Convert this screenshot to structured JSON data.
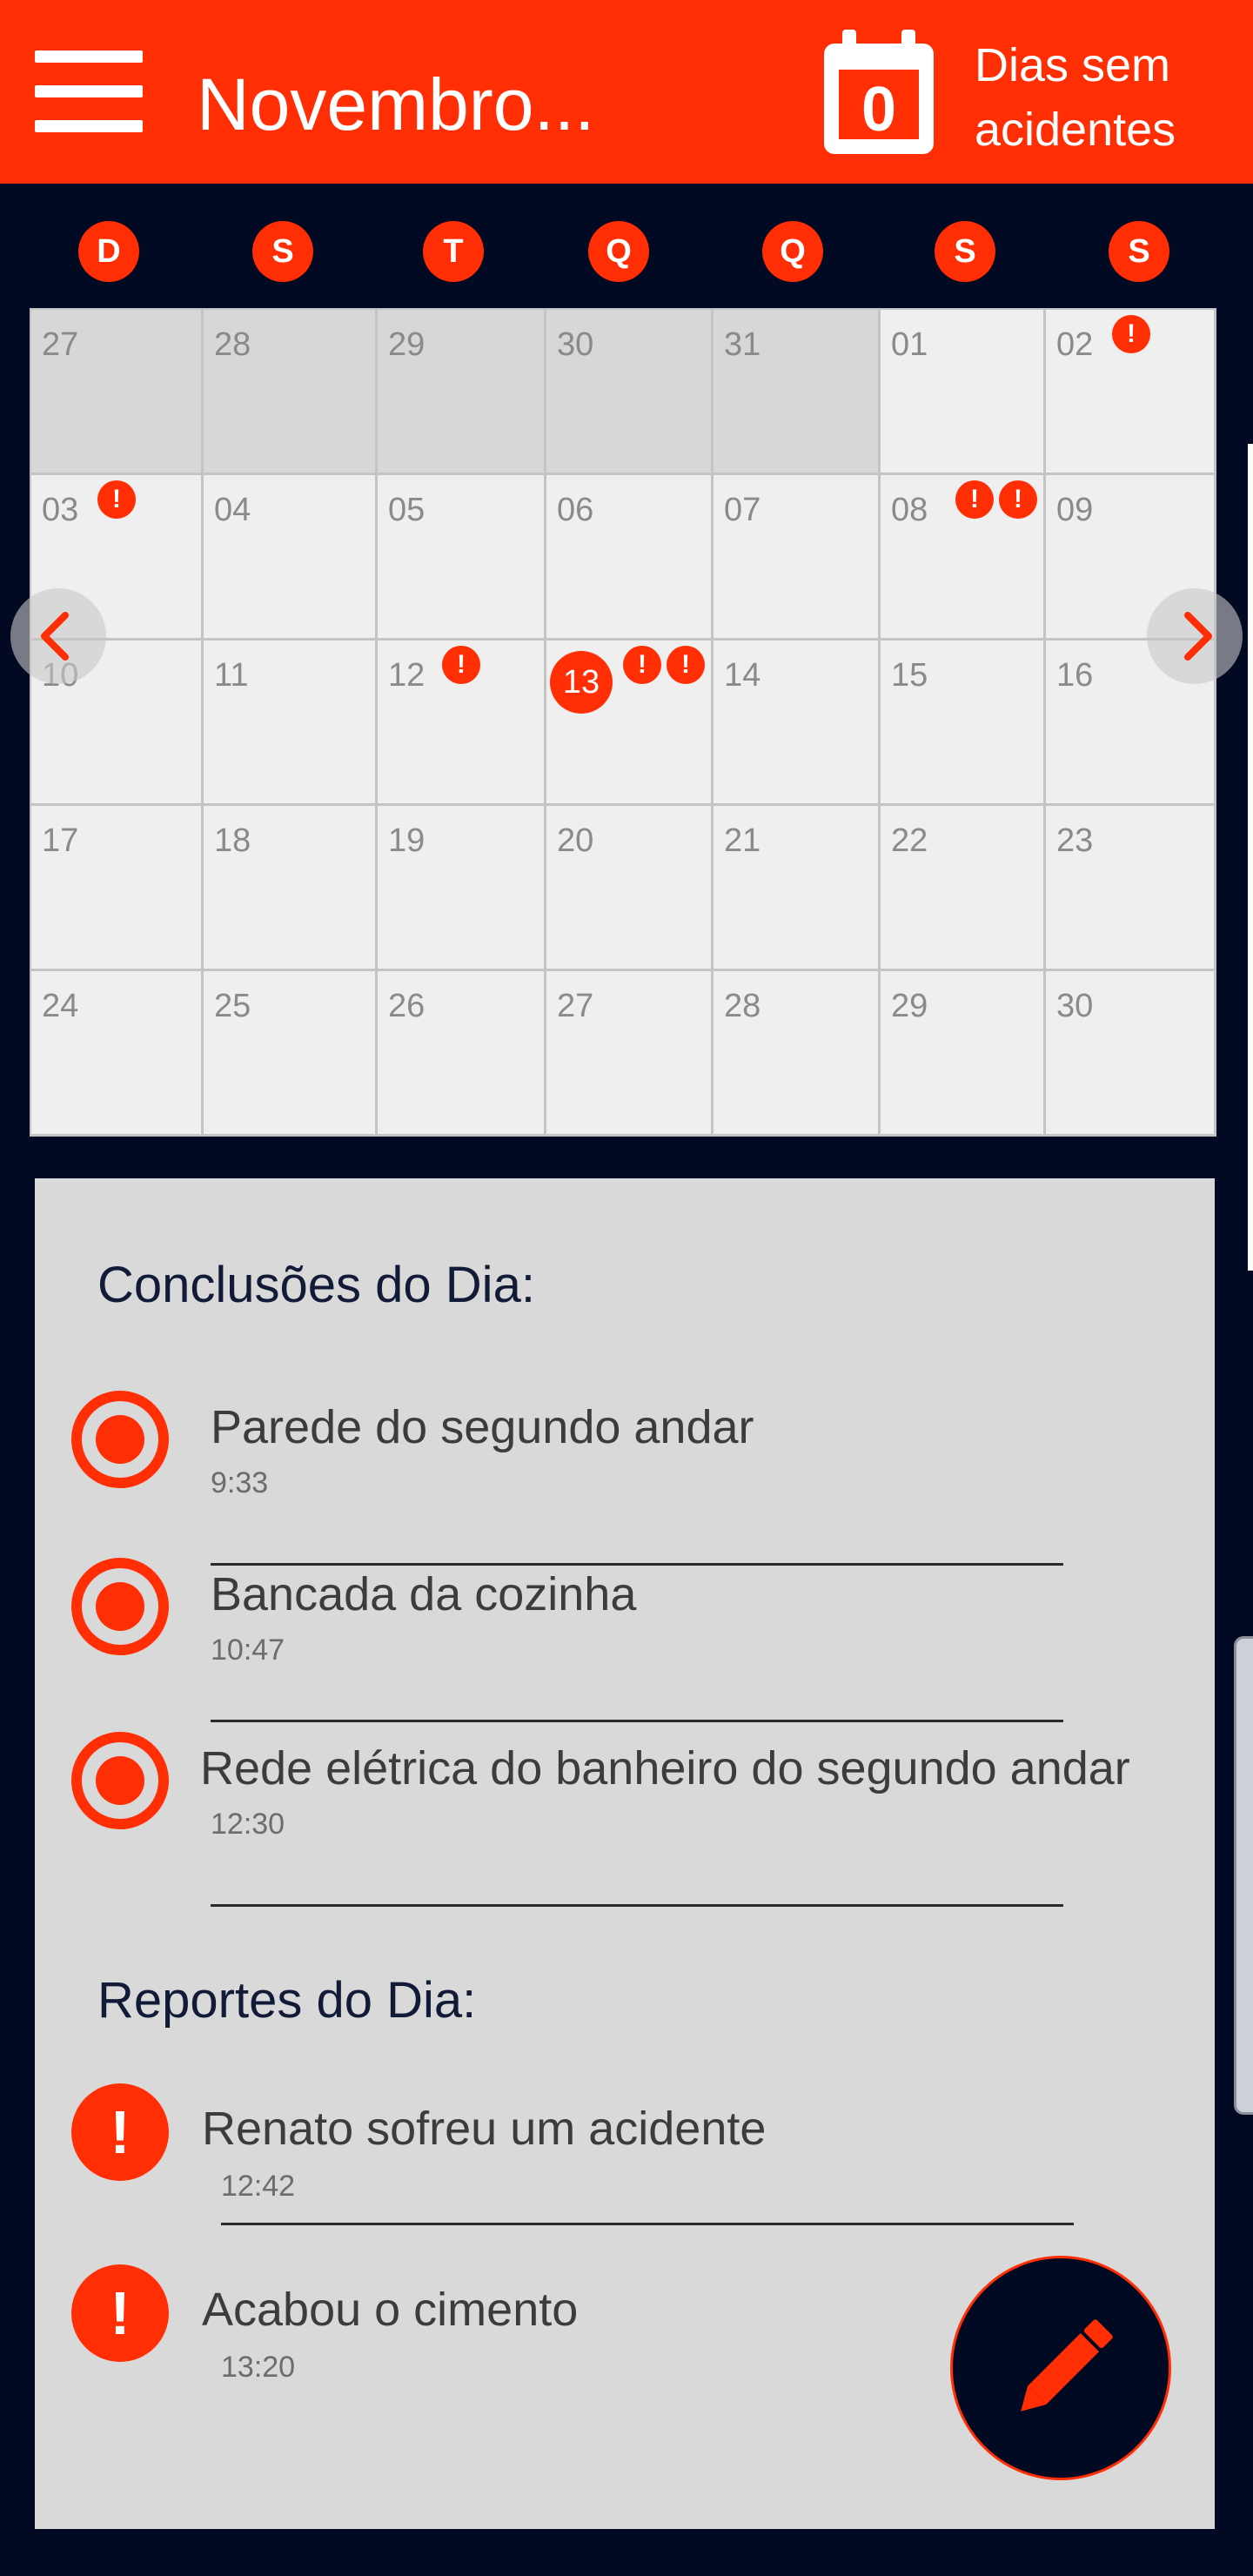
{
  "colors": {
    "accent": "#ff2e05",
    "background": "#020922",
    "panel": "#d9d9d9",
    "grid": "#efefef"
  },
  "header": {
    "menu_icon": "hamburger-menu-icon",
    "title": "Novembro...",
    "calendar_icon": "calendar-icon",
    "streak_value": "0",
    "streak_label_line1": "Dias sem",
    "streak_label_line2": "acidentes"
  },
  "weekdays": [
    "D",
    "S",
    "T",
    "Q",
    "Q",
    "S",
    "S"
  ],
  "calendar": {
    "prev_icon": "chevron-left-icon",
    "next_icon": "chevron-right-icon",
    "today": "13",
    "weeks": [
      [
        {
          "day": "27",
          "other": true
        },
        {
          "day": "28",
          "other": true
        },
        {
          "day": "29",
          "other": true
        },
        {
          "day": "30",
          "other": true
        },
        {
          "day": "31",
          "other": true
        },
        {
          "day": "01"
        },
        {
          "day": "02",
          "alerts": 1
        }
      ],
      [
        {
          "day": "03",
          "alerts": 1
        },
        {
          "day": "04"
        },
        {
          "day": "05"
        },
        {
          "day": "06"
        },
        {
          "day": "07"
        },
        {
          "day": "08",
          "alerts": 2
        },
        {
          "day": "09"
        }
      ],
      [
        {
          "day": "10"
        },
        {
          "day": "11"
        },
        {
          "day": "12",
          "alerts": 1
        },
        {
          "day": "13",
          "alerts": 2,
          "today": true
        },
        {
          "day": "14"
        },
        {
          "day": "15"
        },
        {
          "day": "16"
        }
      ],
      [
        {
          "day": "17"
        },
        {
          "day": "18"
        },
        {
          "day": "19"
        },
        {
          "day": "20"
        },
        {
          "day": "21"
        },
        {
          "day": "22"
        },
        {
          "day": "23"
        }
      ],
      [
        {
          "day": "24"
        },
        {
          "day": "25"
        },
        {
          "day": "26"
        },
        {
          "day": "27"
        },
        {
          "day": "28"
        },
        {
          "day": "29"
        },
        {
          "day": "30"
        }
      ]
    ],
    "alert_glyph": "!"
  },
  "conclusions": {
    "title": "Conclusões do Dia:",
    "items": [
      {
        "label": "Parede do segundo andar",
        "time": "9:33"
      },
      {
        "label": "Bancada da cozinha",
        "time": "10:47"
      },
      {
        "label": "Rede elétrica do banheiro do segundo andar",
        "time": "12:30"
      }
    ]
  },
  "reports": {
    "title": "Reportes do Dia:",
    "items": [
      {
        "label": "Renato sofreu um acidente",
        "time": "12:42"
      },
      {
        "label": "Acabou o cimento",
        "time": "13:20"
      }
    ]
  },
  "fab": {
    "icon": "pencil-icon"
  }
}
